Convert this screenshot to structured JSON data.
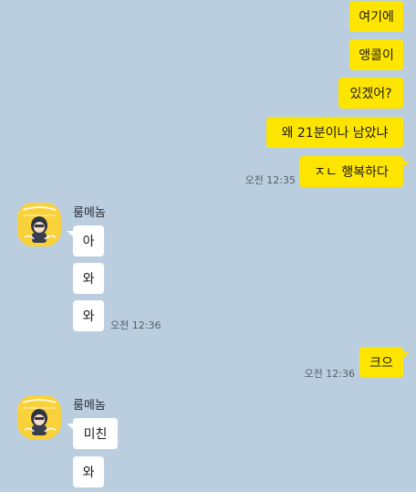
{
  "messages_top": [
    {
      "text": "여기에"
    },
    {
      "text": "앵콜이"
    },
    {
      "text": "있겠어?"
    },
    {
      "text": "왜 21분이나 남았냐"
    },
    {
      "text": "ㅈㄴ 행복하다"
    }
  ],
  "time_1": "오전 12:35",
  "group_1": {
    "sender": "룸메놈",
    "messages": [
      "아",
      "와",
      "와"
    ],
    "time": "오전 12:36"
  },
  "mine_2": {
    "text": "크으",
    "time": "오전 12:36"
  },
  "group_2": {
    "sender": "룸메놈",
    "messages": [
      "미친",
      "와"
    ]
  },
  "colors": {
    "background": "#bacee0",
    "my_bubble": "#fee500",
    "their_bubble": "#ffffff",
    "avatar_bg": "#f9d23b"
  }
}
